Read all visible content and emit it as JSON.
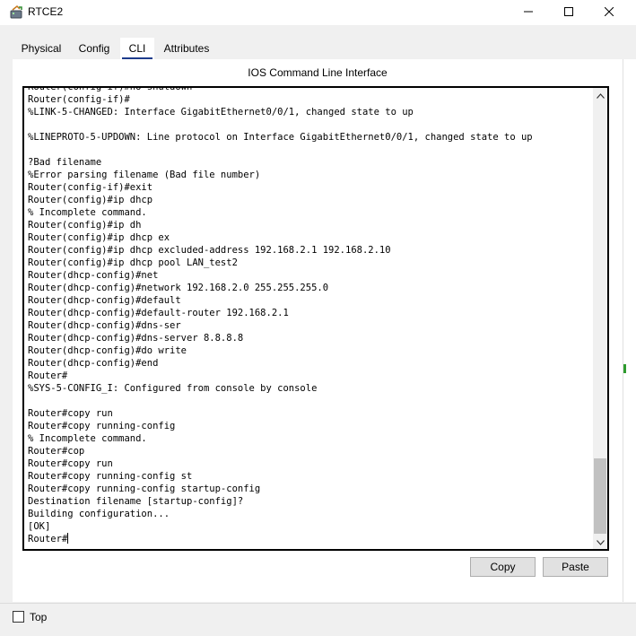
{
  "window": {
    "title": "RTCE2",
    "icon": "router-icon",
    "controls": [
      "minimize-icon",
      "maximize-icon",
      "close-icon"
    ]
  },
  "tabs": [
    {
      "label": "Physical",
      "active": false
    },
    {
      "label": "Config",
      "active": false
    },
    {
      "label": "CLI",
      "active": true
    },
    {
      "label": "Attributes",
      "active": false
    }
  ],
  "cli": {
    "heading": "IOS Command Line Interface",
    "lines": [
      "Router(config-if)#no shutdown",
      "Router(config-if)#",
      "%LINK-5-CHANGED: Interface GigabitEthernet0/0/1, changed state to up",
      "",
      "%LINEPROTO-5-UPDOWN: Line protocol on Interface GigabitEthernet0/0/1, changed state to up",
      "",
      "?Bad filename",
      "%Error parsing filename (Bad file number)",
      "Router(config-if)#exit",
      "Router(config)#ip dhcp",
      "% Incomplete command.",
      "Router(config)#ip dh",
      "Router(config)#ip dhcp ex",
      "Router(config)#ip dhcp excluded-address 192.168.2.1 192.168.2.10",
      "Router(config)#ip dhcp pool LAN_test2",
      "Router(dhcp-config)#net",
      "Router(dhcp-config)#network 192.168.2.0 255.255.255.0",
      "Router(dhcp-config)#default",
      "Router(dhcp-config)#default-router 192.168.2.1",
      "Router(dhcp-config)#dns-ser",
      "Router(dhcp-config)#dns-server 8.8.8.8",
      "Router(dhcp-config)#do write",
      "Router(dhcp-config)#end",
      "Router#",
      "%SYS-5-CONFIG_I: Configured from console by console",
      "",
      "Router#copy run",
      "Router#copy running-config",
      "% Incomplete command.",
      "Router#cop",
      "Router#copy run",
      "Router#copy running-config st",
      "Router#copy running-config startup-config",
      "Destination filename [startup-config]?",
      "Building configuration...",
      "[OK]",
      "Router#"
    ],
    "copy_label": "Copy",
    "paste_label": "Paste"
  },
  "footer": {
    "top_label": "Top",
    "top_checked": false
  },
  "colors": {
    "active_tab_underline": "#1e3c8c",
    "window_bg": "#f0f0f0",
    "terminal_border": "#000000"
  }
}
